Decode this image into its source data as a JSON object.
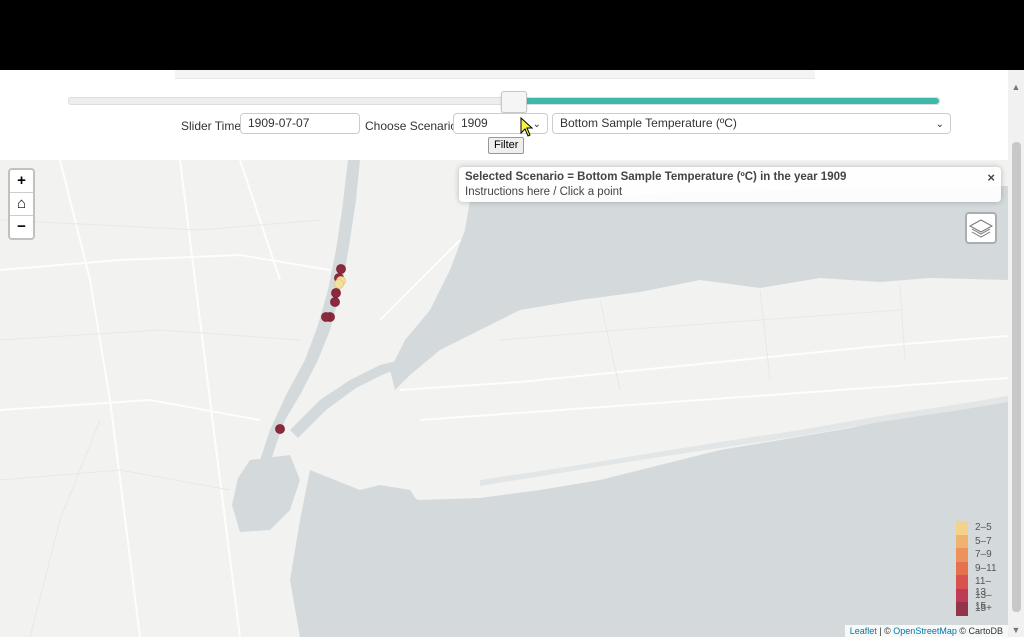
{
  "controls": {
    "slider_time_label": "Slider Time:",
    "slider_time_value": "1909-07-07",
    "slider_progress": 0.51,
    "choose_scenario_label": "Choose Scenario:",
    "year_select": "1909",
    "variable_select": "Bottom Sample Temperature (ºC)",
    "filter_button": "Filter"
  },
  "map": {
    "zoom_in": "+",
    "home": "⌂",
    "zoom_out": "−",
    "info_title": "Selected Scenario = Bottom Sample Temperature (ºC) in the year 1909",
    "info_subtitle": "Instructions here / Click a point",
    "info_close": "×",
    "legend": [
      {
        "label": "2–5",
        "color": "#f3d28b"
      },
      {
        "label": "5–7",
        "color": "#efb36f"
      },
      {
        "label": "7–9",
        "color": "#ec935b"
      },
      {
        "label": "9–11",
        "color": "#e6714f"
      },
      {
        "label": "11–13",
        "color": "#d9524e"
      },
      {
        "label": "13–15",
        "color": "#bf3a55"
      },
      {
        "label": "15+",
        "color": "#93344a"
      }
    ],
    "attribution": {
      "leaflet": "Leaflet",
      "sep1": " | © ",
      "osm": "OpenStreetMap",
      "sep2": " © ",
      "carto": "CartoDB"
    },
    "colors": {
      "water": "#d4dadc",
      "land": "#f2f2f0",
      "slider_fill": "#3db8aa",
      "marker_dark": "#8b2a3c",
      "marker_light": "#f5dfa0"
    }
  }
}
